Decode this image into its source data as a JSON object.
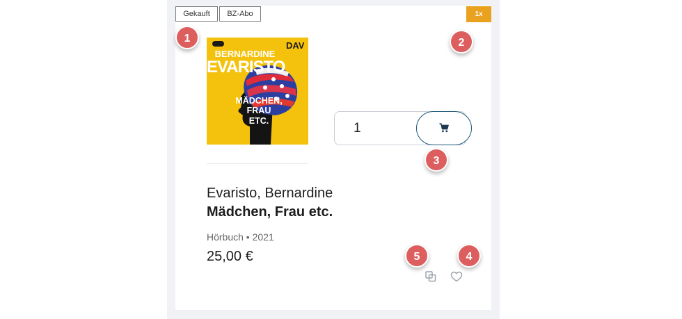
{
  "tags": {
    "bought": "Gekauft",
    "subscription": "BZ-Abo"
  },
  "quantity_badge": "1x",
  "markers": [
    "1",
    "2",
    "3",
    "4",
    "5"
  ],
  "cover": {
    "publisher": "DAV",
    "author_first": "BERNARDINE",
    "author_last": "EVARISTO",
    "title_lines": [
      "MÄDCHEN,",
      "FRAU",
      "ETC."
    ],
    "background_color": "#f4c20d"
  },
  "cart": {
    "quantity": "1",
    "icon": "cart-icon"
  },
  "product": {
    "author": "Evaristo, Bernardine",
    "title": "Mädchen, Frau etc.",
    "format_year": "Hörbuch • 2021",
    "price": "25,00 €"
  },
  "actions": {
    "compare_icon": "compare-icon",
    "wishlist_icon": "heart-icon"
  },
  "colors": {
    "accent": "#1d5679",
    "badge": "#e9a21f",
    "marker": "#dc5e5e"
  }
}
